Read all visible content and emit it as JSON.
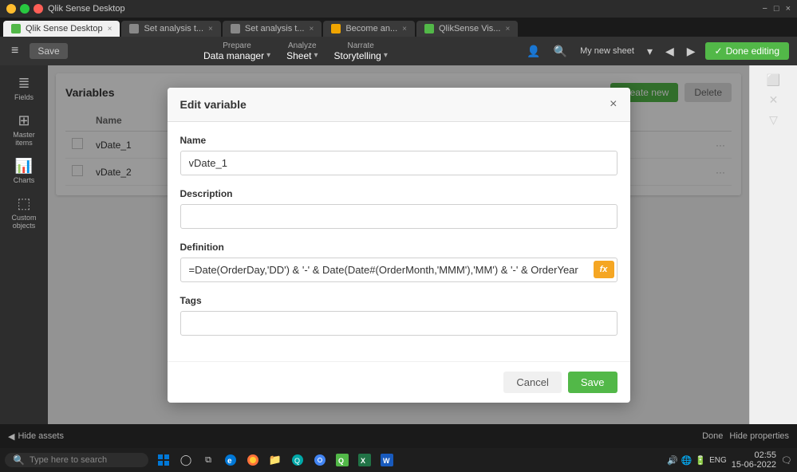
{
  "browser": {
    "title": "Qlik Sense Desktop",
    "controls": {
      "minimize": "−",
      "maximize": "□",
      "close": "×"
    }
  },
  "tabs": [
    {
      "id": "tab1",
      "label": "Qlik Sense Desktop",
      "active": true
    },
    {
      "id": "tab2",
      "label": "Set analysis t...",
      "active": false
    },
    {
      "id": "tab3",
      "label": "Set analysis t...",
      "active": false
    },
    {
      "id": "tab4",
      "label": "Become an...",
      "active": false
    },
    {
      "id": "tab5",
      "label": "QlikSense Vis...",
      "active": false
    }
  ],
  "appbar": {
    "save_label": "Save",
    "menu_icon": "≡",
    "prepare_label": "Prepare",
    "prepare_value": "Data manager",
    "analyze_label": "Analyze",
    "analyze_value": "Sheet",
    "narrate_label": "Narrate",
    "narrate_value": "Storytelling",
    "new_sheet_label": "My new sheet",
    "done_editing_label": "Done editing"
  },
  "sidebar": {
    "items": [
      {
        "icon": "☰",
        "label": "Fields"
      },
      {
        "icon": "⊞",
        "label": "Master items"
      },
      {
        "icon": "📊",
        "label": "Charts"
      },
      {
        "icon": "⬜",
        "label": "Custom objects"
      }
    ]
  },
  "variables_panel": {
    "title": "Variables",
    "create_new_label": "Create new",
    "delete_label": "Delete",
    "table": {
      "columns": [
        {
          "key": "checkbox",
          "label": ""
        },
        {
          "key": "name",
          "label": "Name"
        }
      ],
      "rows": [
        {
          "id": "row1",
          "name": "vDate_1"
        },
        {
          "id": "row2",
          "name": "vDate_2"
        }
      ]
    }
  },
  "modal": {
    "title": "Edit variable",
    "close_icon": "×",
    "name_label": "Name",
    "name_value": "vDate_1",
    "description_label": "Description",
    "description_value": "",
    "definition_label": "Definition",
    "definition_value": "=Date(OrderDay,'DD') & '-' & Date(Date#(OrderMonth,'MMM'),'MM') & '-' & OrderYear",
    "fx_label": "fx",
    "tags_label": "Tags",
    "tags_value": "",
    "cancel_label": "Cancel",
    "save_label": "Save"
  },
  "bottom_bar": {
    "hide_assets_label": "Hide assets",
    "hide_assets_icon": "◀",
    "done_label": "Done",
    "hide_properties_label": "Hide properties"
  },
  "taskbar": {
    "search_placeholder": "Type here to search",
    "search_icon": "🔍",
    "time": "02:55",
    "date": "15-06-2022",
    "icons": [
      "⊞",
      "🔎",
      "🗣",
      "📂",
      "⚙",
      "🟦",
      "🟠",
      "🌐",
      "💚",
      "📗"
    ]
  }
}
